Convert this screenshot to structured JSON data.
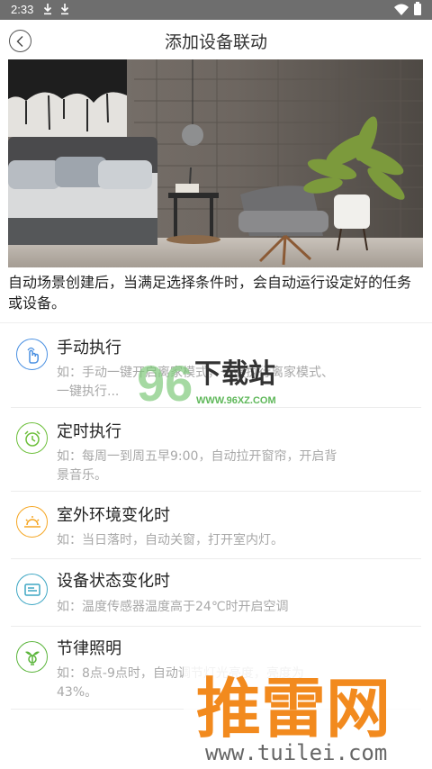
{
  "status_bar": {
    "time": "2:33"
  },
  "header": {
    "title": "添加设备联动"
  },
  "intro_text": "自动场景创建后，当满足选择条件时，会自动运行设定好的任务或设备。",
  "items": [
    {
      "title": "手动执行",
      "desc": "如：手动一键开启离家模式，一键执行离家模式、一键执行...",
      "icon": "hand-tap-icon",
      "color": "#4a90e2"
    },
    {
      "title": "定时执行",
      "desc": "如：每周一到周五早9:00，自动拉开窗帘，开启背景音乐。",
      "icon": "alarm-clock-icon",
      "color": "#6cbf3a"
    },
    {
      "title": "室外环境变化时",
      "desc": "如：当日落时，自动关窗，打开室内灯。",
      "icon": "sunset-icon",
      "color": "#f5a623"
    },
    {
      "title": "设备状态变化时",
      "desc": "如：温度传感器温度高于24℃时开启空调",
      "icon": "device-status-icon",
      "color": "#3fa7c4"
    },
    {
      "title": "节律照明",
      "desc": "如：8点-9点时，自动调节灯光亮度，亮度为43%。",
      "icon": "plant-bulb-icon",
      "color": "#5bb53b"
    }
  ],
  "watermarks": {
    "site1_name": "下载站",
    "site1_url": "WWW.96XZ.COM",
    "site1_digits": "96",
    "site2_name": "推雷网",
    "site2_url": "www.tuilei.com"
  }
}
